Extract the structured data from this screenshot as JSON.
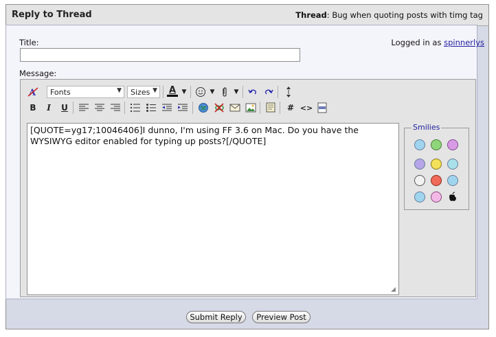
{
  "header": {
    "title": "Reply to Thread",
    "thread_label": "Thread",
    "thread_separator": ":",
    "thread_title": "Bug when quoting posts with timg tag"
  },
  "form": {
    "title_label": "Title:",
    "title_value": "",
    "message_label": "Message:",
    "logged_in_prefix": "Logged in as",
    "username": "spinnerlys"
  },
  "toolbar": {
    "fonts_label": "Fonts",
    "sizes_label": "Sizes",
    "icons_row1": [
      "remove-format-icon",
      "font-color-icon",
      "smiley-insert-icon",
      "attachment-icon",
      "undo-icon",
      "redo-icon",
      "resize-editor-icon"
    ],
    "icons_row2": [
      "bold-icon",
      "italic-icon",
      "underline-icon",
      "align-left-icon",
      "align-center-icon",
      "align-right-icon",
      "ordered-list-icon",
      "unordered-list-icon",
      "outdent-icon",
      "indent-icon",
      "insert-link-icon",
      "remove-link-icon",
      "insert-email-icon",
      "insert-image-icon",
      "quote-icon",
      "code-icon",
      "html-icon",
      "php-icon"
    ],
    "bold_glyph": "B",
    "italic_glyph": "I",
    "underline_glyph": "U",
    "font_color_glyph": "A",
    "code_glyph": "#",
    "html_glyph": "<>"
  },
  "message": {
    "text": "[QUOTE=yg17;10046406]I dunno, I'm using FF 3.6 on Mac. Do you have the WYSIWYG editor enabled for typing up posts?[/QUOTE]"
  },
  "smilies": {
    "legend": "Smilies",
    "items": [
      "smile",
      "grin",
      "tongue",
      "frown",
      "eek",
      "confused",
      "rolleyes",
      "mad",
      "cool-blue",
      "cool",
      "redface",
      "apple"
    ]
  },
  "buttons": {
    "submit": "Submit Reply",
    "preview": "Preview Post"
  },
  "colors": {
    "link": "#1f1f9e",
    "font_color_bar": "#000000"
  }
}
